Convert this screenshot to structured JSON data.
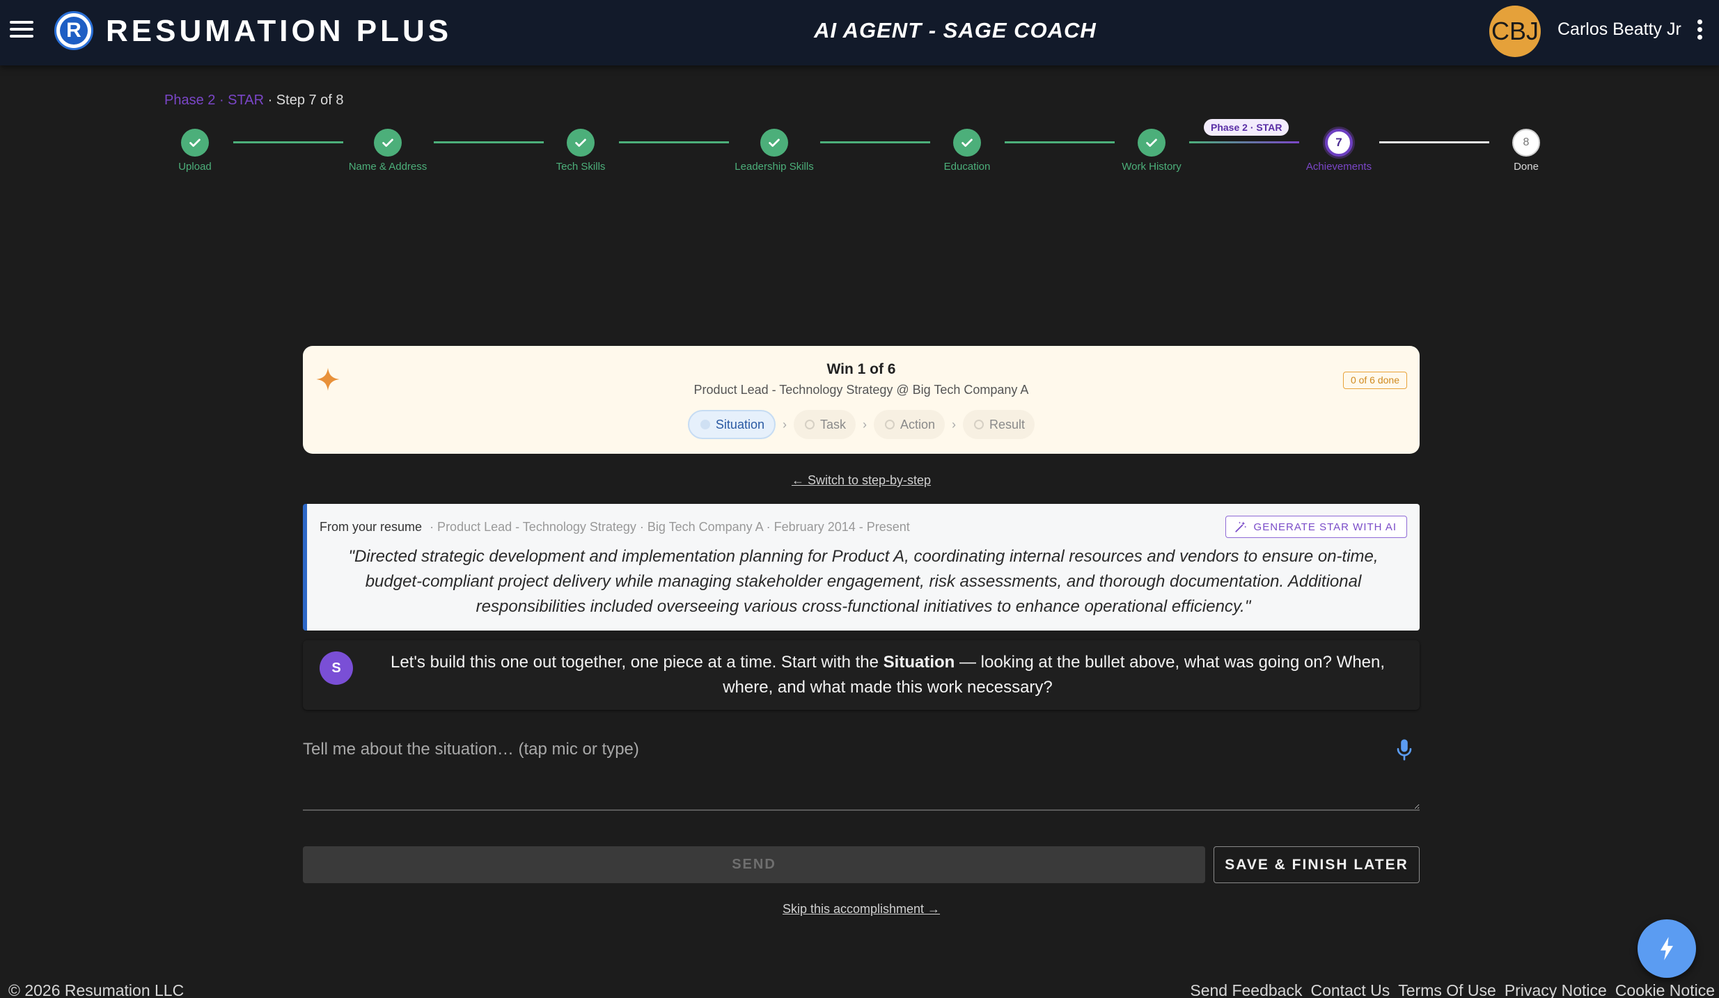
{
  "header": {
    "logo_letter": "R",
    "app_title": "RESUMATION PLUS",
    "agent_title": "AI AGENT - SAGE COACH",
    "avatar_initials": "CBJ",
    "user_name": "Carlos Beatty Jr"
  },
  "progress": {
    "phase_label": "Phase 2 · STAR",
    "step_label": " · Step 7 of 8",
    "phase_pill": "Phase 2 · STAR",
    "current_step": 7,
    "total_steps": 8,
    "steps": [
      {
        "label": "Upload",
        "state": "done"
      },
      {
        "label": "Name & Address",
        "state": "done"
      },
      {
        "label": "Tech Skills",
        "state": "done"
      },
      {
        "label": "Leadership Skills",
        "state": "done"
      },
      {
        "label": "Education",
        "state": "done"
      },
      {
        "label": "Work History",
        "state": "done"
      },
      {
        "label": "Achievements",
        "state": "current",
        "number": "7"
      },
      {
        "label": "Done",
        "state": "future",
        "number": "8"
      }
    ]
  },
  "win_card": {
    "title": "Win 1 of 6",
    "subtitle": "Product Lead - Technology Strategy @ Big Tech Company A",
    "done_badge": "0 of 6 done",
    "star_steps": [
      "Situation",
      "Task",
      "Action",
      "Result"
    ],
    "active_step": "Situation"
  },
  "switch_link": "← Switch to step-by-step",
  "resume": {
    "label": "From your resume",
    "meta": "· Product Lead - Technology Strategy · Big Tech Company A · February 2014 - Present",
    "generate_button": "GENERATE STAR WITH AI",
    "quote": "\"Directed strategic development and implementation planning for Product A, coordinating internal resources and vendors to ensure on-time, budget-compliant project delivery while managing stakeholder engagement, risk assessments, and thorough documentation. Additional responsibilities included overseeing various cross-functional initiatives to enhance operational efficiency.\""
  },
  "coach": {
    "avatar_letter": "S",
    "message_before": "Let's build this one out together, one piece at a time. Start with the ",
    "message_bold": "Situation",
    "message_after": " — looking at the bullet above, what was going on? When, where, and what made this work necessary?"
  },
  "reply": {
    "value": "",
    "placeholder": "Tell me about the situation… (tap mic or type)"
  },
  "actions": {
    "send": "SEND",
    "save": "SAVE & FINISH LATER",
    "skip": "Skip this accomplishment →"
  },
  "footer": {
    "copyright": "© 2026 Resumation LLC",
    "links": [
      "Send Feedback",
      "Contact Us",
      "Terms Of Use",
      "Privacy Notice",
      "Cookie Notice"
    ]
  },
  "colors": {
    "header_bg": "#121a2a",
    "done_green": "#4caf7a",
    "phase_purple": "#7a46c7",
    "card_cream": "#fff9ec",
    "accent_blue": "#2d68c7",
    "fab_blue": "#5b9cf2"
  },
  "icons": {
    "menu": "hamburger-icon",
    "kebab": "more-vert-icon",
    "sparkle": "sparkle-icon",
    "magic": "magic-wand-icon",
    "mic": "microphone-icon",
    "fab": "lightning-bolt-icon",
    "check": "check-icon"
  }
}
